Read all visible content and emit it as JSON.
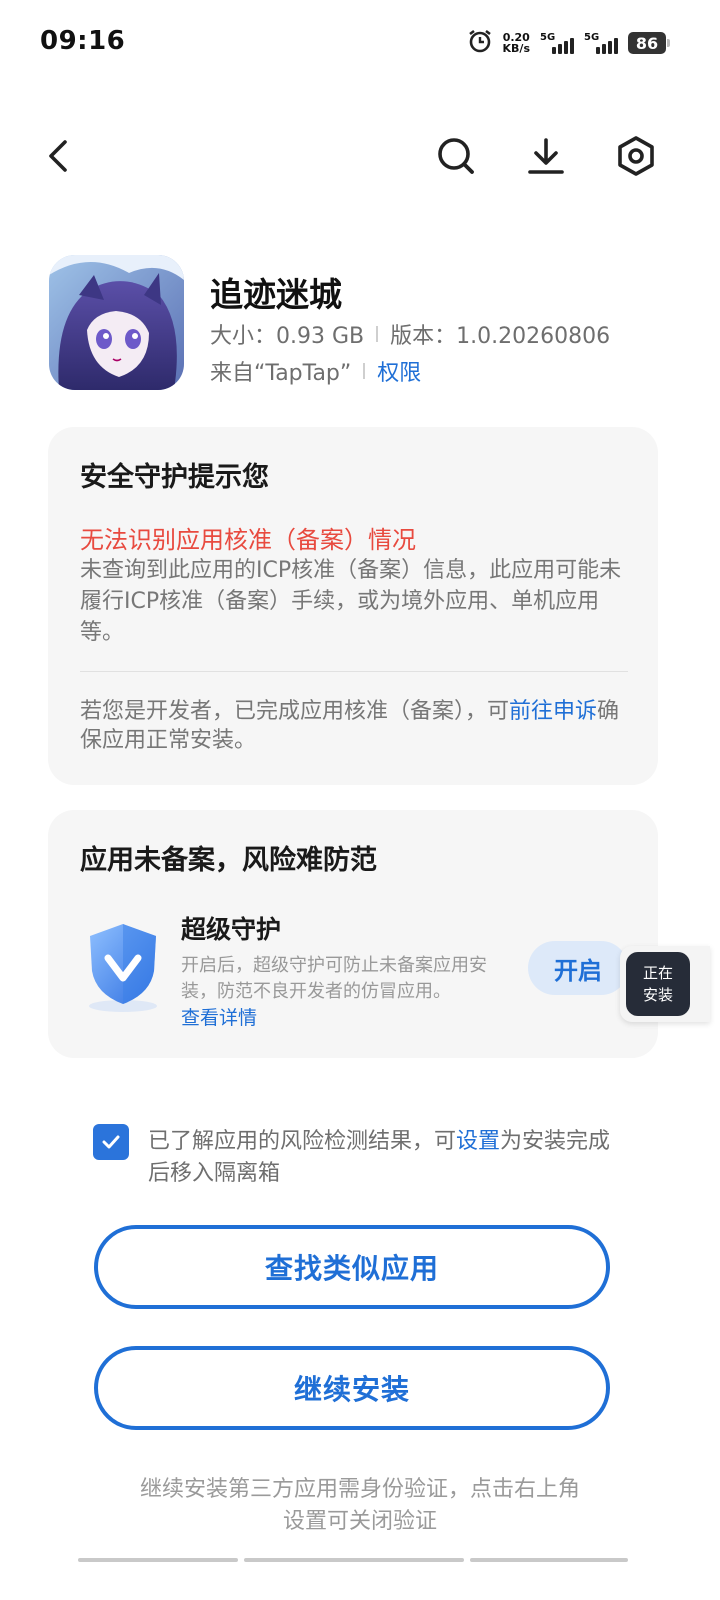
{
  "status_bar": {
    "time": "09:16",
    "net_speed_value": "0.20",
    "net_speed_unit": "KB/s",
    "sim1": "5G",
    "sim2": "5G",
    "battery": "86"
  },
  "nav": {
    "back_icon": "chevron-left-icon",
    "search_icon": "search-icon",
    "download_icon": "download-icon",
    "settings_icon": "settings-icon"
  },
  "app": {
    "name": "追迹迷城",
    "size": "大小：0.93 GB",
    "version": "版本：1.0.20260806",
    "source": "来自“TapTap”",
    "permissions": "权限"
  },
  "security_card": {
    "title": "安全守护提示您",
    "warning": "无法识别应用核准（备案）情况",
    "description": "未查询到此应用的ICP核准（备案）信息，此应用可能未履行ICP核准（备案）手续，或为境外应用、单机应用等。",
    "developer_note_prefix": "若您是开发者，已完成应用核准（备案），可",
    "developer_link": "前往申诉",
    "developer_note_suffix": "确保应用正常安装。"
  },
  "risk_card": {
    "title": "应用未备案，风险难防范",
    "feature_title": "超级守护",
    "feature_desc": "开启后，超级守护可防止未备案应用安装，防范不良开发者的仿冒应用。",
    "details_link": "查看详情",
    "enable_button": "开启"
  },
  "floating_badge": {
    "line1": "正在",
    "line2": "安装"
  },
  "consent": {
    "checked": true,
    "text_prefix": "已了解应用的风险检测结果，可",
    "link": "设置",
    "text_suffix": "为安装完成后移入隔离箱"
  },
  "actions": {
    "find_similar": "查找类似应用",
    "continue_install": "继续安装"
  },
  "footnote": "继续安装第三方应用需身份验证，点击右上角设置可关闭验证",
  "colors": {
    "accent": "#1f6fd6",
    "warning": "#e84a3f",
    "card_bg": "#f6f6f6"
  }
}
